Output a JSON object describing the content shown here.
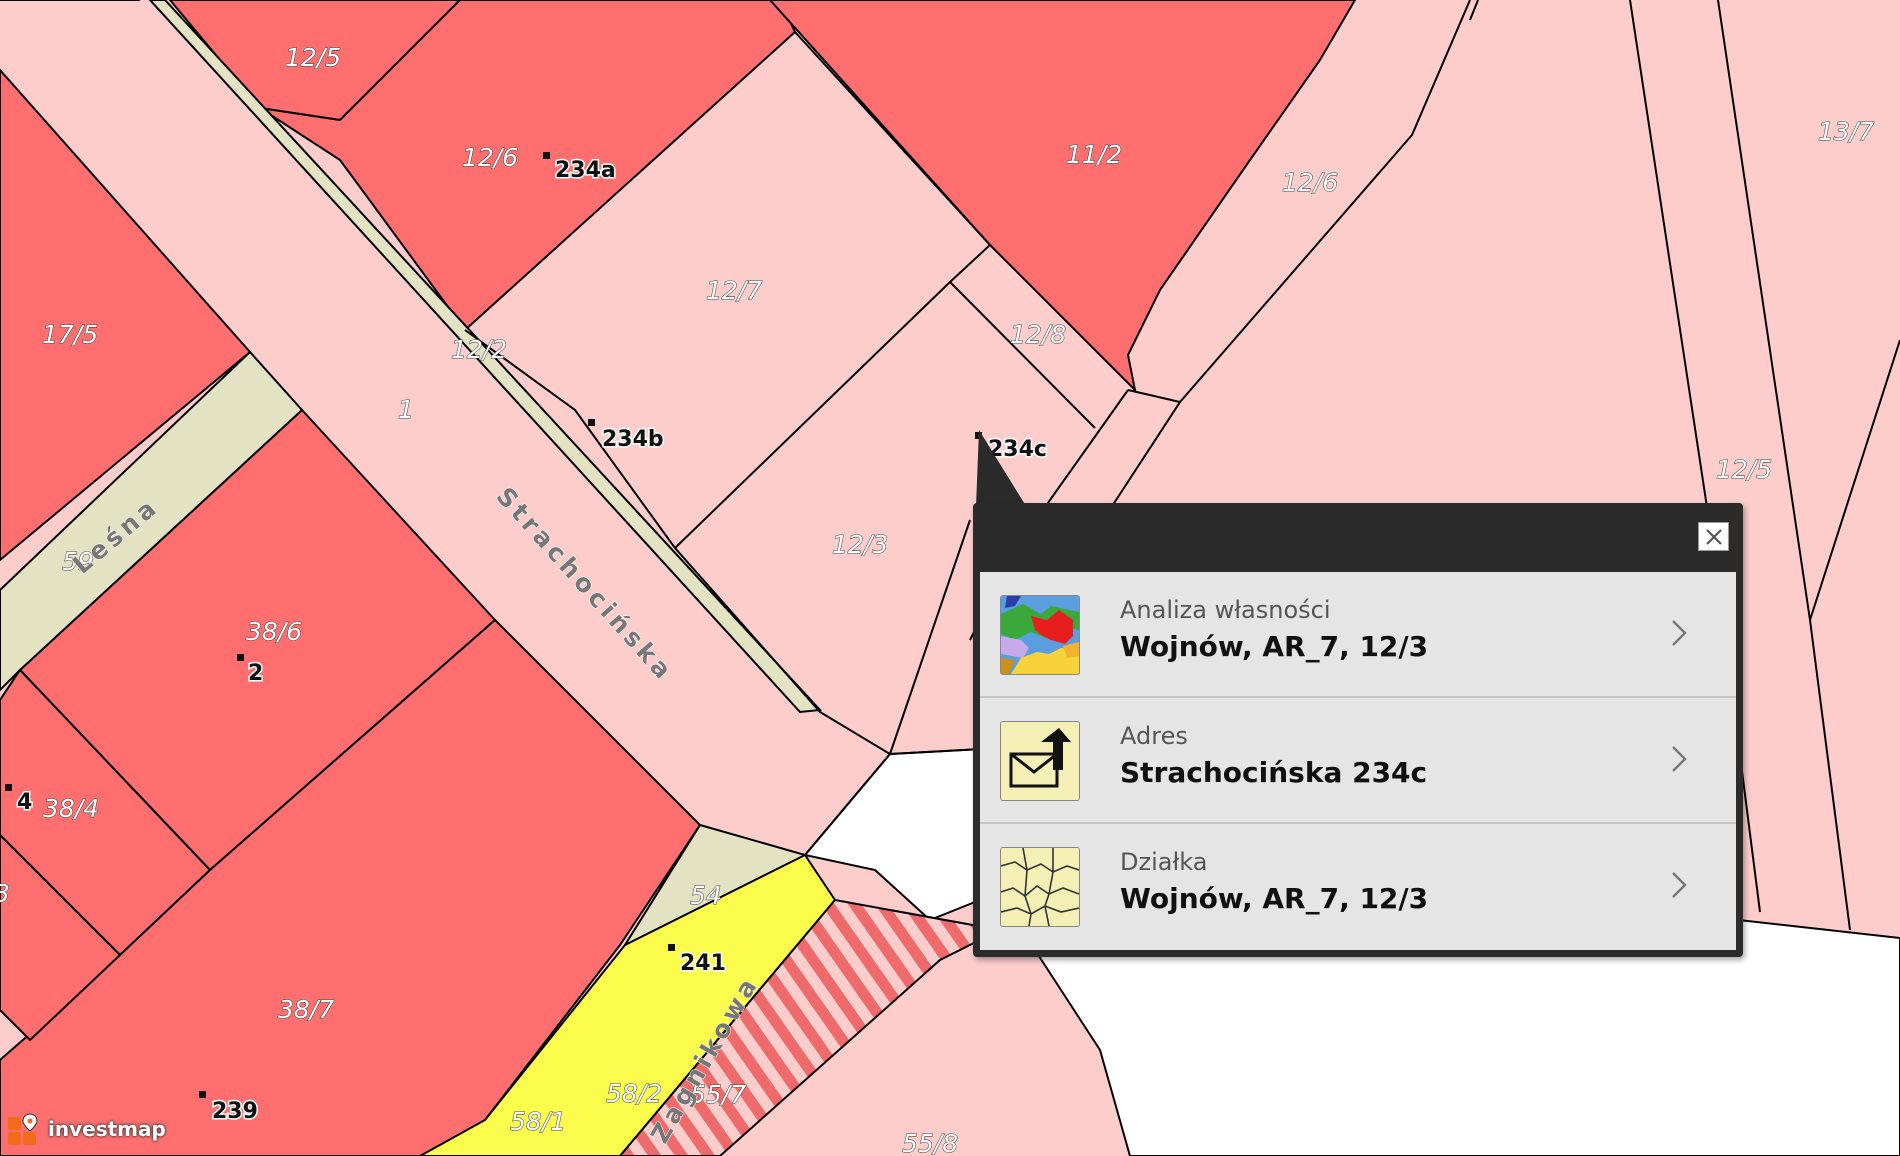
{
  "map": {
    "colors": {
      "owned_dark": "#ff6f6f",
      "owned_light": "#fdcdcc",
      "road_beige": "#e3e3c3",
      "zone_yellow": "#fcfc4d",
      "stripe_red": "#ef6b6b",
      "boundary": "#000000"
    },
    "parcel_labels": [
      "12/5",
      "12/6",
      "11/2",
      "12/6",
      "13/7",
      "12/7",
      "12/8",
      "17/5",
      "12/2",
      "1",
      "12/3",
      "12/5",
      "59",
      "38/6",
      "38/4",
      "54",
      "38/7",
      "58/2",
      "55/7",
      "58/1",
      "55/8",
      "3"
    ],
    "address_labels": [
      "234a",
      "234b",
      "234c",
      "2",
      "4",
      "241",
      "239"
    ],
    "street_labels": [
      "Strachocińska",
      "Leśna",
      "Zagnikowa"
    ]
  },
  "popup": {
    "close_icon": "close-icon",
    "items": [
      {
        "icon": "ownership-analysis-icon",
        "caption": "Analiza własności",
        "value": "Wojnów, AR_7, 12/3"
      },
      {
        "icon": "address-envelope-icon",
        "caption": "Adres",
        "value": "Strachocińska 234c"
      },
      {
        "icon": "parcel-map-icon",
        "caption": "Działka",
        "value": "Wojnów, AR_7, 12/3"
      }
    ]
  },
  "brand": {
    "name": "investmap",
    "logo_icon": "investmap-logo-icon"
  }
}
